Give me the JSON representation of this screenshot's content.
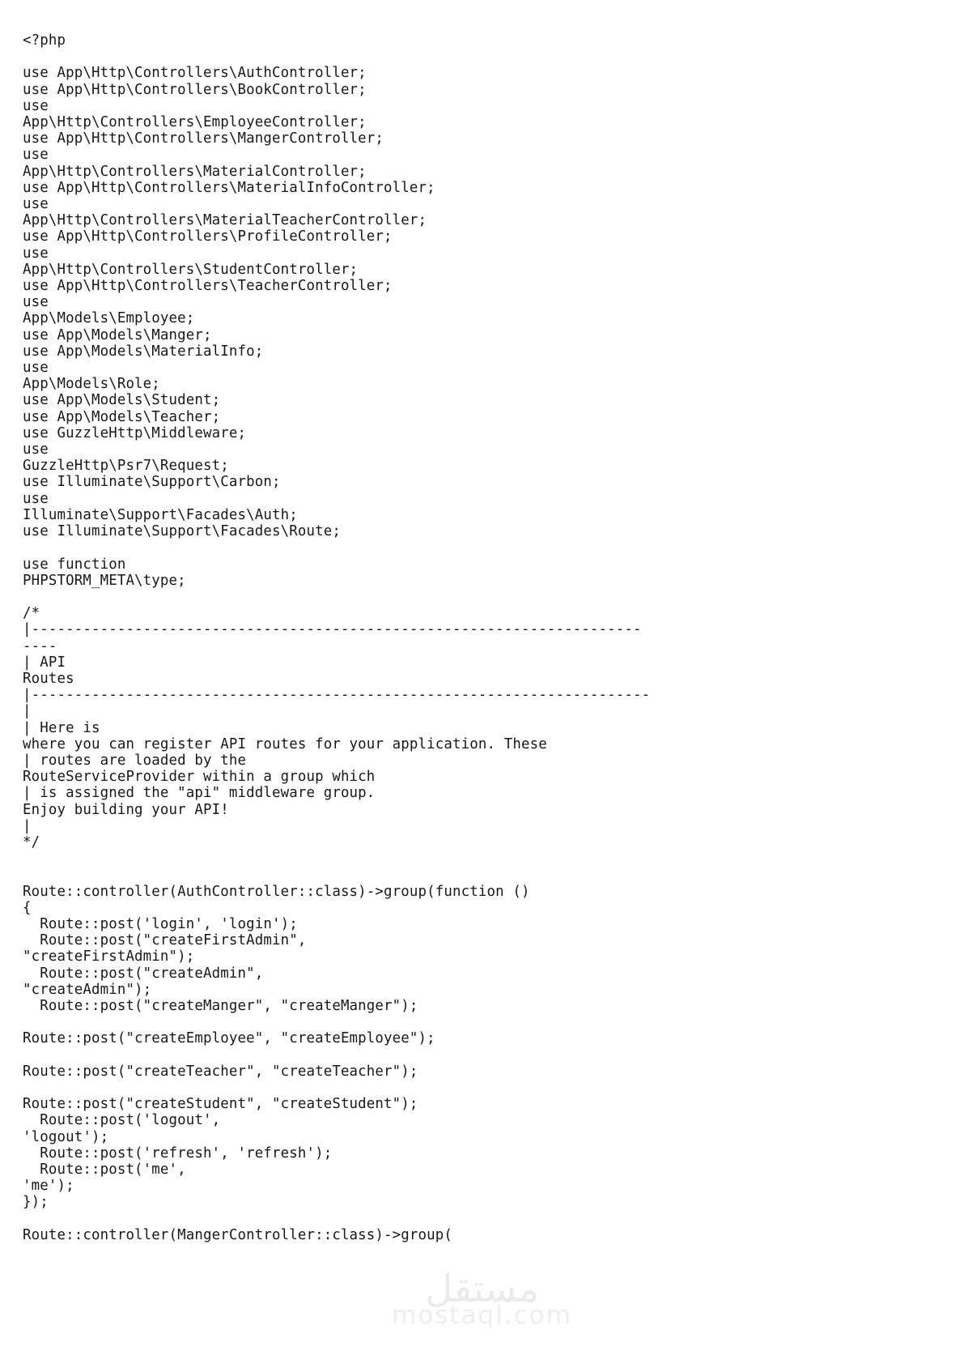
{
  "document": {
    "type": "code-listing",
    "language": "php",
    "filename_inferred": "api.php",
    "background_color": "#ffffff",
    "text_color": "#16191c"
  },
  "watermark": {
    "arabic_text": "مستقل",
    "latin_text": "mostaql.com",
    "color": "#e9ebed"
  },
  "code": {
    "lines": [
      "<?php",
      "",
      "use App\\Http\\Controllers\\AuthController;",
      "use App\\Http\\Controllers\\BookController;",
      "use",
      "App\\Http\\Controllers\\EmployeeController;",
      "use App\\Http\\Controllers\\MangerController;",
      "use",
      "App\\Http\\Controllers\\MaterialController;",
      "use App\\Http\\Controllers\\MaterialInfoController;",
      "use",
      "App\\Http\\Controllers\\MaterialTeacherController;",
      "use App\\Http\\Controllers\\ProfileController;",
      "use",
      "App\\Http\\Controllers\\StudentController;",
      "use App\\Http\\Controllers\\TeacherController;",
      "use",
      "App\\Models\\Employee;",
      "use App\\Models\\Manger;",
      "use App\\Models\\MaterialInfo;",
      "use",
      "App\\Models\\Role;",
      "use App\\Models\\Student;",
      "use App\\Models\\Teacher;",
      "use GuzzleHttp\\Middleware;",
      "use",
      "GuzzleHttp\\Psr7\\Request;",
      "use Illuminate\\Support\\Carbon;",
      "use",
      "Illuminate\\Support\\Facades\\Auth;",
      "use Illuminate\\Support\\Facades\\Route;",
      "",
      "use function",
      "PHPSTORM_META\\type;",
      "",
      "/*",
      "|-----------------------------------------------------------------------",
      "----",
      "| API",
      "Routes",
      "|------------------------------------------------------------------------",
      "|",
      "| Here is",
      "where you can register API routes for your application. These",
      "| routes are loaded by the",
      "RouteServiceProvider within a group which",
      "| is assigned the \"api\" middleware group.",
      "Enjoy building your API!",
      "|",
      "*/",
      "",
      "",
      "Route::controller(AuthController::class)->group(function ()",
      "{",
      "  Route::post('login', 'login');",
      "  Route::post(\"createFirstAdmin\",",
      "\"createFirstAdmin\");",
      "  Route::post(\"createAdmin\",",
      "\"createAdmin\");",
      "  Route::post(\"createManger\", \"createManger\");",
      "",
      "Route::post(\"createEmployee\", \"createEmployee\");",
      "",
      "Route::post(\"createTeacher\", \"createTeacher\");",
      "",
      "Route::post(\"createStudent\", \"createStudent\");",
      "  Route::post('logout',",
      "'logout');",
      "  Route::post('refresh', 'refresh');",
      "  Route::post('me',",
      "'me');",
      "});",
      "",
      "Route::controller(MangerController::class)->group("
    ]
  }
}
